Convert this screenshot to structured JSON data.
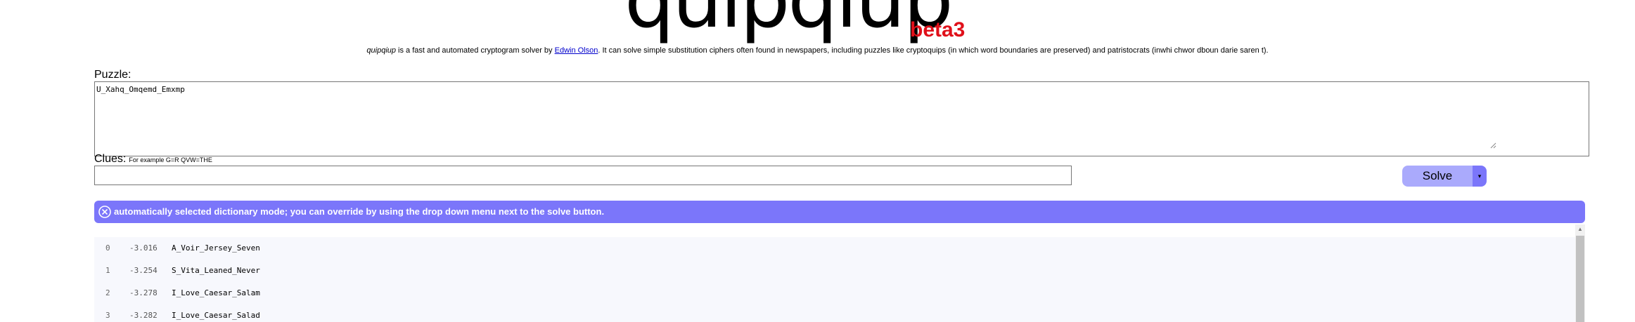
{
  "logo": {
    "word": "quipqiup",
    "beta": "beta3"
  },
  "intro": {
    "app_name": "quipqiup",
    "text_before_link": " is a fast and automated cryptogram solver by ",
    "author_link": "Edwin Olson",
    "text_after_link": ". It can solve simple substitution ciphers often found in newspapers, including puzzles like cryptoquips (in which word boundaries are preserved) and patristocrats (inwhi chwor dboun darie saren t)."
  },
  "puzzle": {
    "label": "Puzzle:",
    "value": "U_Xahq_Omqemd_Emxmp"
  },
  "clues": {
    "label": "Clues:",
    "hint": "For example G=R QVW=THE",
    "value": ""
  },
  "solve": {
    "label": "Solve",
    "dropdown_glyph": "▾"
  },
  "notice": {
    "close_glyph": "⊗",
    "text": "automatically selected dictionary mode; you can override by using the drop down menu next to the solve button."
  },
  "results": [
    {
      "index": "0",
      "score": "-3.016",
      "text": "A_Voir_Jersey_Seven"
    },
    {
      "index": "1",
      "score": "-3.254",
      "text": "S_Vita_Leaned_Never"
    },
    {
      "index": "2",
      "score": "-3.278",
      "text": "I_Love_Caesar_Salam"
    },
    {
      "index": "3",
      "score": "-3.282",
      "text": "I_Love_Caesar_Salad"
    }
  ],
  "colors": {
    "accent": "#7b76fa",
    "button": "#aaaafc",
    "beta": "#e0101a",
    "link": "#0000cc"
  }
}
